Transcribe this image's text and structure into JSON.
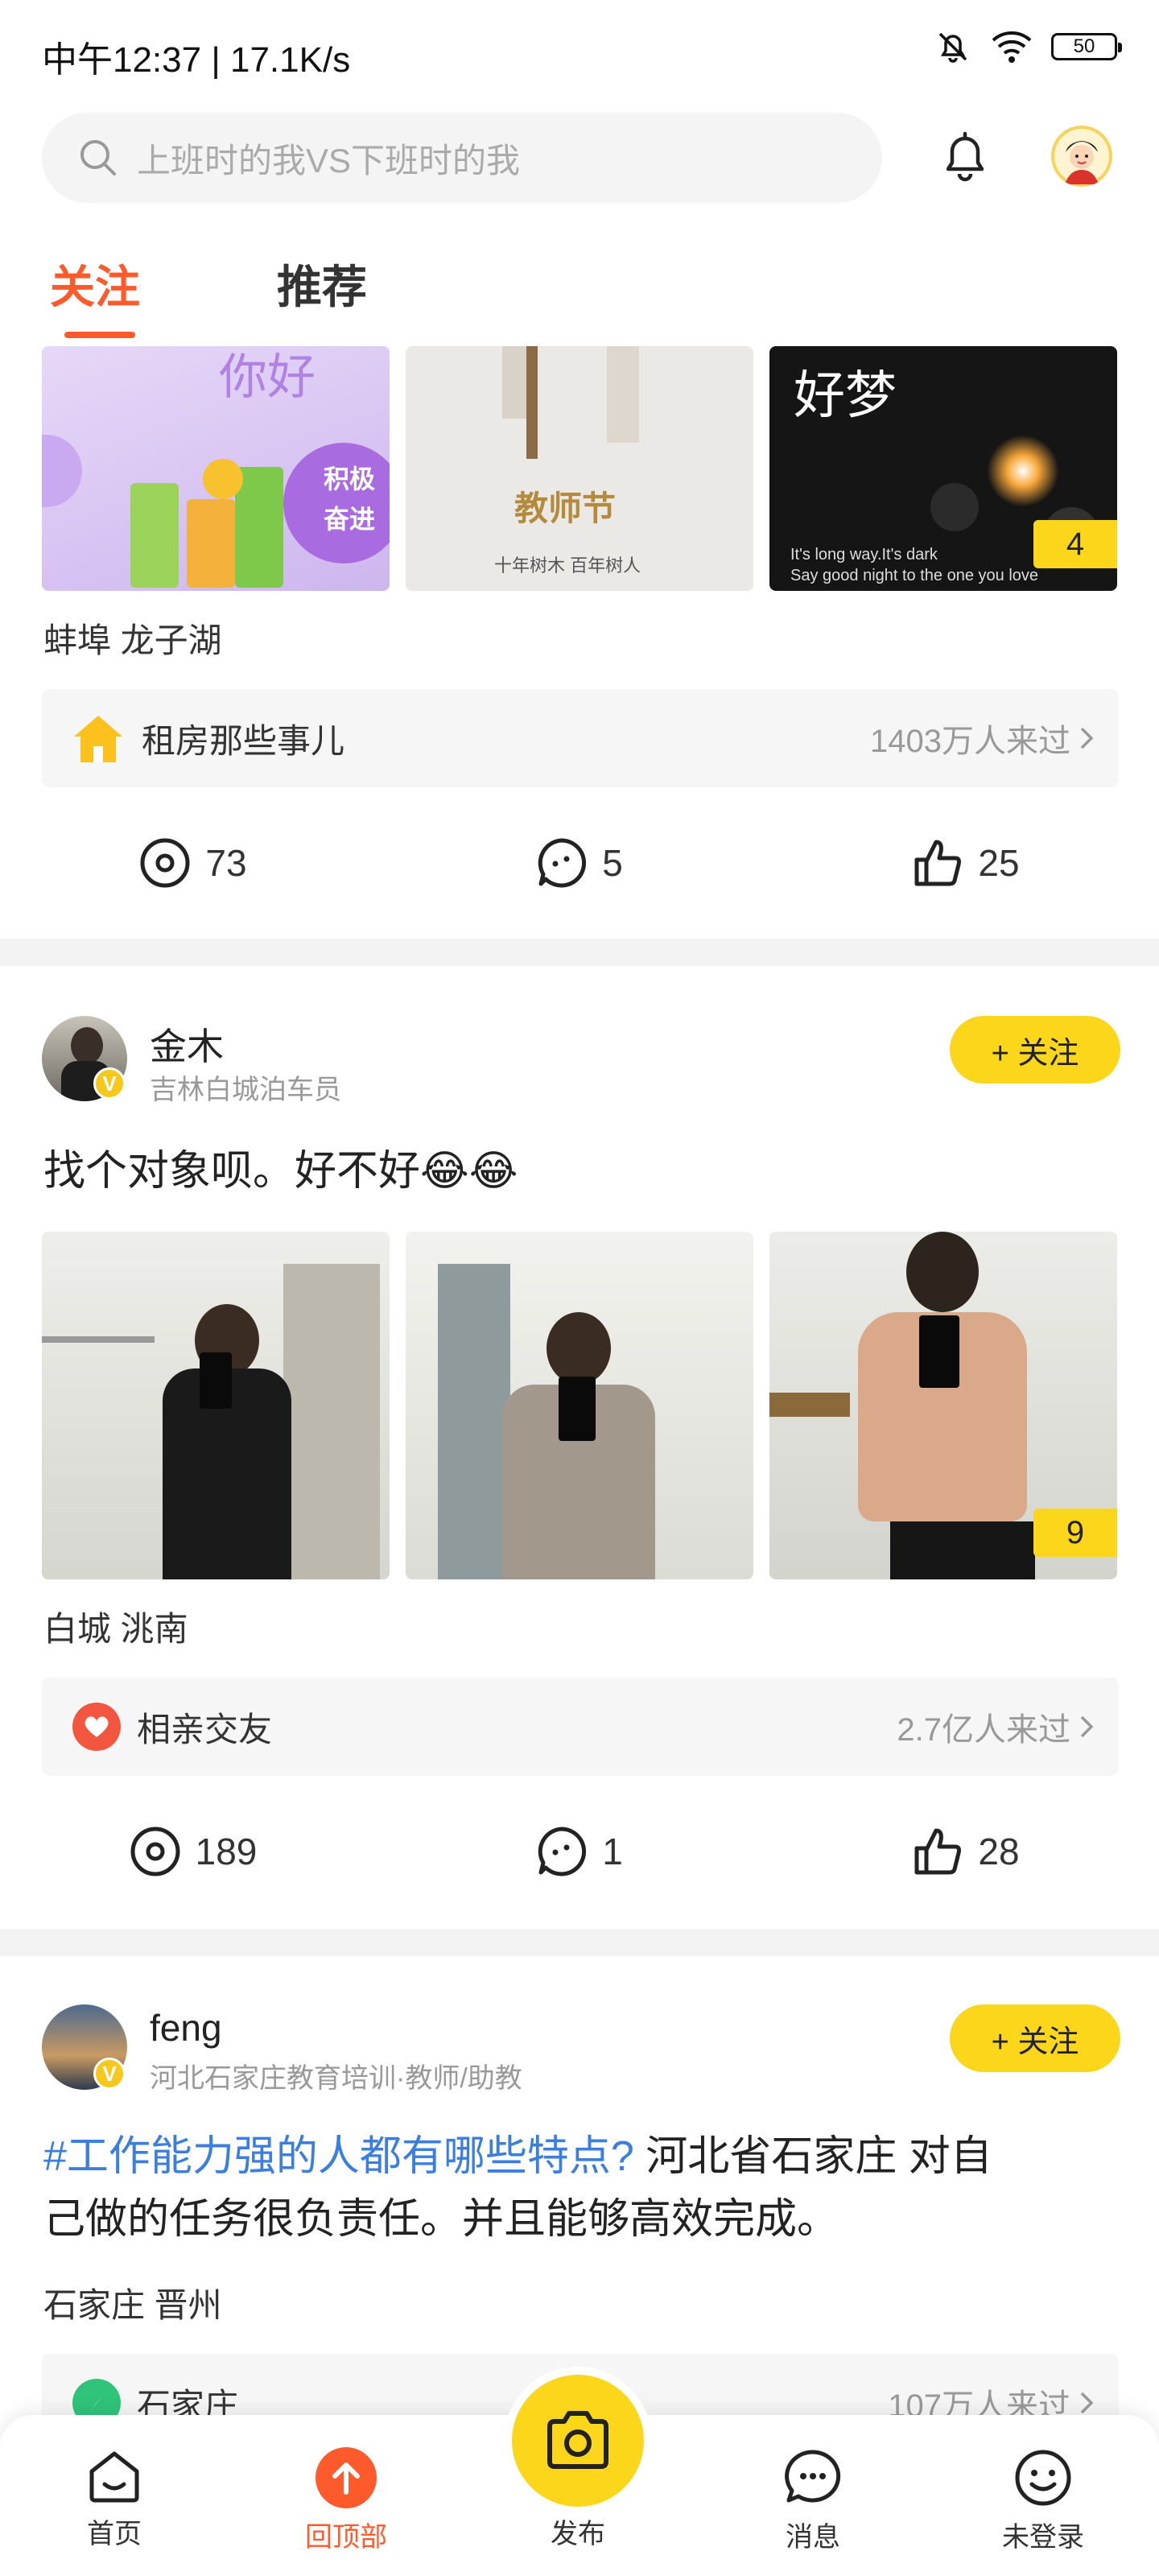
{
  "status_bar": {
    "time": "中午12:37 | 17.1K/s",
    "battery": "50"
  },
  "search": {
    "placeholder": "上班时的我VS下班时的我"
  },
  "tabs": [
    {
      "label": "关注"
    },
    {
      "label": "推荐"
    }
  ],
  "posts": [
    {
      "location": "蚌埠 龙子湖",
      "image_count_badge": "4",
      "image_texts": {
        "img1_a": "积极",
        "img1_b": "奋进",
        "img1_c": "你好",
        "img2_a": "教师节",
        "img2_b": "十年树木 百年树人",
        "img3_a": "好梦",
        "img3_b": "It's long way.It's dark",
        "img3_c": "Say good night to the one you love"
      },
      "topic": {
        "name": "租房那些事儿",
        "count": "1403万人来过"
      },
      "stats": {
        "views": "73",
        "comments": "5",
        "likes": "25"
      }
    },
    {
      "author": {
        "name": "金木",
        "subtitle": "吉林白城泊车员"
      },
      "follow_label": "+ 关注",
      "text": "找个对象呗。好不好😂😂",
      "image_count_badge": "9",
      "location": "白城 洮南",
      "topic": {
        "name": "相亲交友",
        "count": "2.7亿人来过"
      },
      "stats": {
        "views": "189",
        "comments": "1",
        "likes": "28"
      }
    },
    {
      "author": {
        "name": "feng",
        "subtitle": "河北石家庄教育培训·教师/助教"
      },
      "follow_label": "+ 关注",
      "hashtag": "#工作能力强的人都有哪些特点?",
      "text_line1": " 河北省石家庄 对自",
      "text_line2": "己做的任务很负责任。并且能够高效完成。",
      "location": "石家庄 晋州",
      "topic": {
        "name": "石家庄",
        "count": "107万人来过"
      }
    }
  ],
  "tabbar": {
    "home": "首页",
    "back_top": "回顶部",
    "publish": "发布",
    "messages": "消息",
    "login": "未登录"
  },
  "colors": {
    "accent": "#ff5a2c",
    "yellow": "#fcd61a",
    "hashtag": "#3a7fe0"
  }
}
